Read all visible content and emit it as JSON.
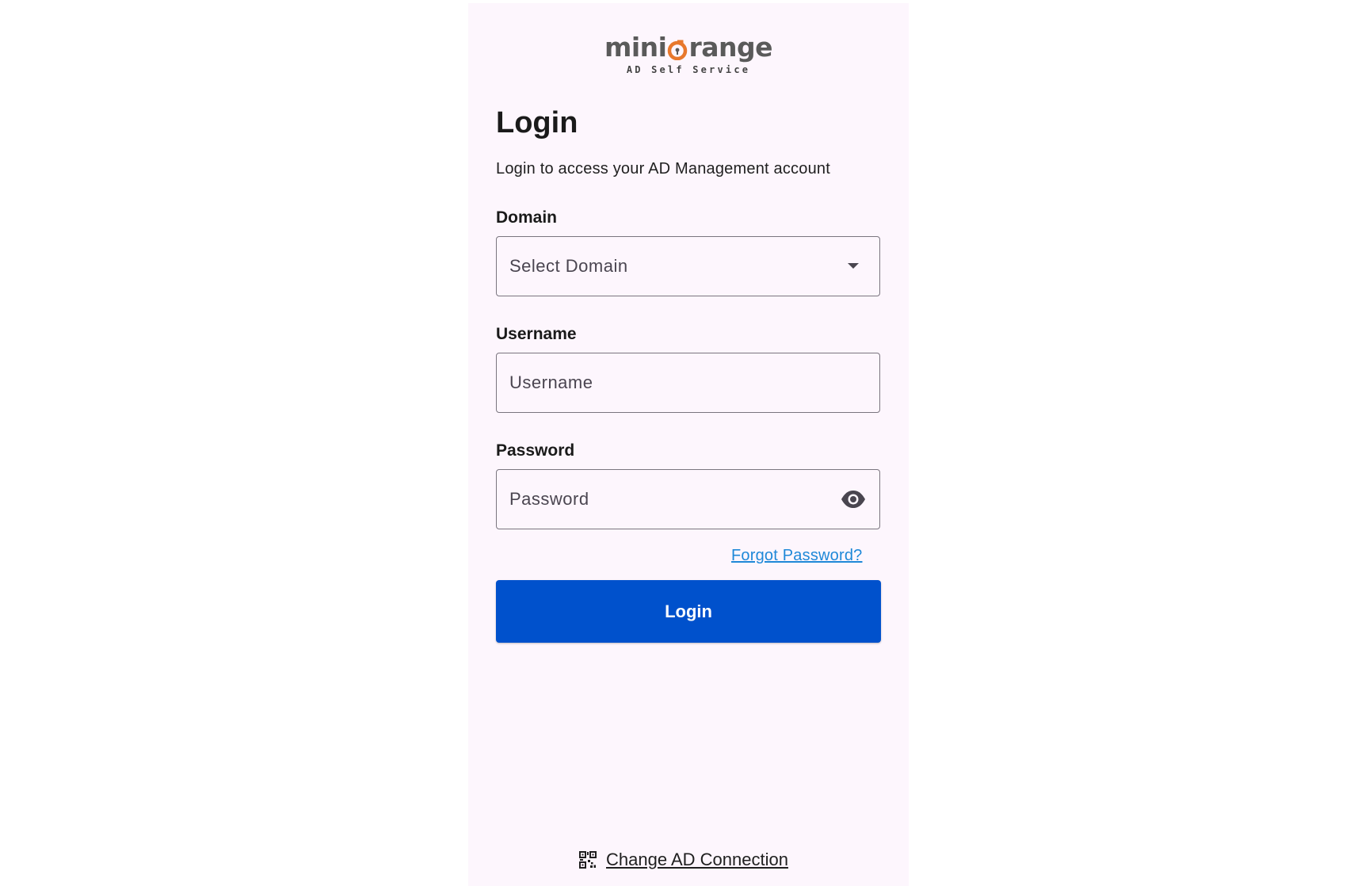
{
  "logo": {
    "brand_left": "mini",
    "brand_right": "range",
    "tagline": "AD Self Service"
  },
  "login": {
    "title": "Login",
    "subtitle": "Login to access your AD Management account",
    "domain": {
      "label": "Domain",
      "placeholder": "Select Domain"
    },
    "username": {
      "label": "Username",
      "placeholder": "Username"
    },
    "password": {
      "label": "Password",
      "placeholder": "Password"
    },
    "forgot_password": "Forgot Password?",
    "submit_label": "Login"
  },
  "footer": {
    "change_connection": "Change AD Connection"
  },
  "colors": {
    "primary": "#0051cc",
    "link": "#1e88d8",
    "logo_accent": "#e8782c",
    "panel_bg": "#fdf6fd"
  },
  "icons": [
    "dropdown-caret-icon",
    "eye-icon",
    "qr-code-icon"
  ]
}
